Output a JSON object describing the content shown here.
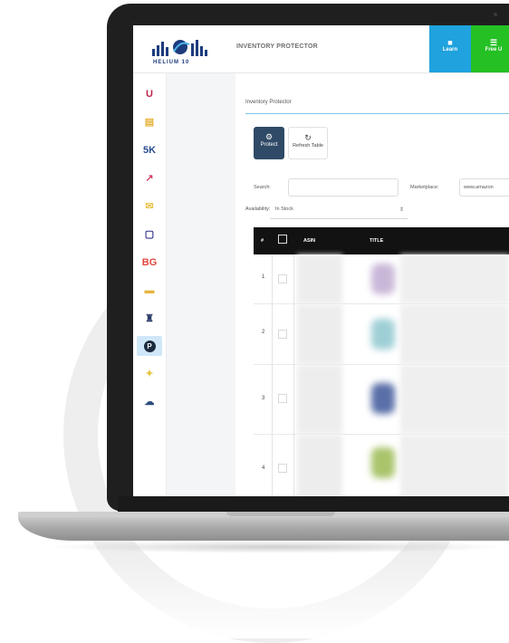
{
  "header": {
    "logo_text": "HELIUM 10",
    "title": "INVENTORY PROTECTOR",
    "learn_label": "Learn",
    "free_label": "Free U"
  },
  "sidebar": {
    "items": [
      {
        "label": "U",
        "color": "#c0244b"
      },
      {
        "label": "▤",
        "color": "#e8b23a"
      },
      {
        "label": "5K",
        "color": "#2a4d8f"
      },
      {
        "label": "↗",
        "color": "#d63d62"
      },
      {
        "label": "✉",
        "color": "#e9c34b"
      },
      {
        "label": "▢",
        "color": "#2d2f8f"
      },
      {
        "label": "BG",
        "color": "#e0463c"
      },
      {
        "label": "▬",
        "color": "#e6b43e"
      },
      {
        "label": "♜",
        "color": "#2c3b6a"
      },
      {
        "label": "P",
        "color": "#1b2a3f",
        "active": true
      },
      {
        "label": "✦",
        "color": "#e7c446"
      },
      {
        "label": "☁",
        "color": "#2d4c7c"
      }
    ]
  },
  "panel": {
    "title": "Inventory Protector",
    "protect_label": "Protect",
    "refresh_label": "Refresh Table",
    "search_label": "Search:",
    "marketplace_label": "Marketplace:",
    "marketplace_value": "www.amazon",
    "availability_label": "Availability:",
    "availability_value": "In Stock"
  },
  "table": {
    "headers": [
      "#",
      "ASIN",
      "TITLE"
    ],
    "rows": [
      {
        "num": "1",
        "img_color": "#c9b7d8"
      },
      {
        "num": "2",
        "img_color": "#9fcfd6"
      },
      {
        "num": "3",
        "img_color": "#5a6fa8"
      },
      {
        "num": "4",
        "img_color": "#a9c46b"
      }
    ]
  },
  "colors": {
    "learn_button": "#1fa2de",
    "free_button": "#24c024",
    "protect_button": "#2f4a66",
    "table_header": "#121212",
    "accent_rule": "#7ec6ea"
  }
}
